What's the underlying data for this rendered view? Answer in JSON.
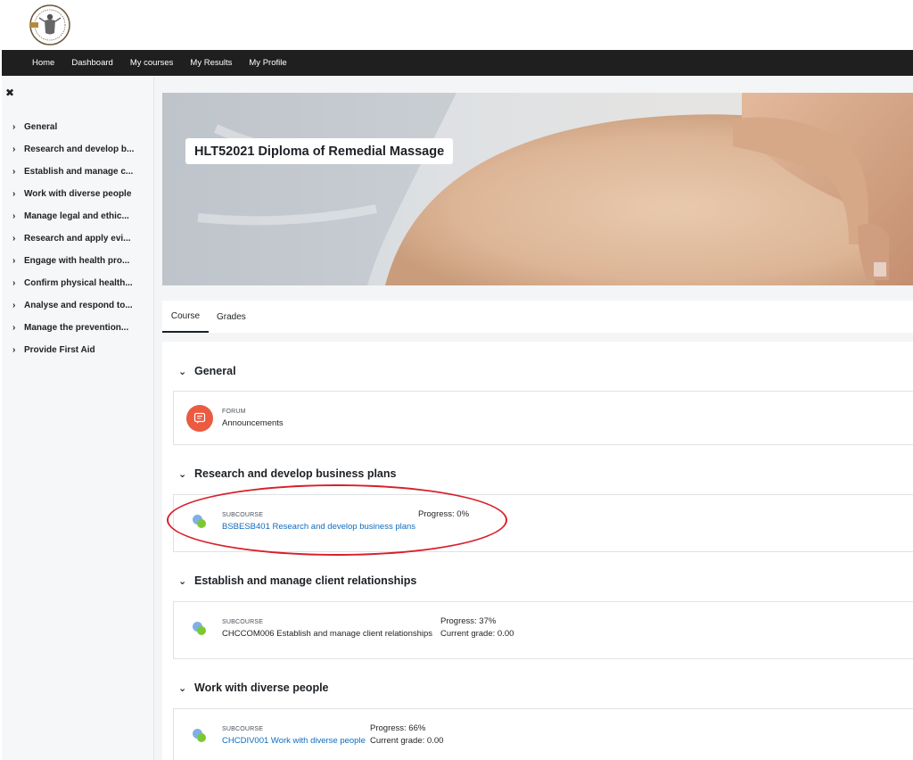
{
  "nav": {
    "items": [
      "Home",
      "Dashboard",
      "My courses",
      "My Results",
      "My Profile"
    ]
  },
  "sidebar": {
    "items": [
      "General",
      "Research and develop b...",
      "Establish and manage c...",
      "Work with diverse people",
      "Manage legal and ethic...",
      "Research and apply evi...",
      "Engage with health pro...",
      "Confirm physical health...",
      "Analyse and respond to...",
      "Manage the prevention...",
      "Provide First Aid"
    ]
  },
  "course": {
    "title": "HLT52021 Diploma of Remedial Massage"
  },
  "tabs": {
    "course": "Course",
    "grades": "Grades"
  },
  "sections": [
    {
      "title": "General",
      "activity": {
        "type": "FORUM",
        "name": "Announcements"
      }
    },
    {
      "title": "Research and develop business plans",
      "activity": {
        "type": "SUBCOURSE",
        "name": "BSBESB401 Research and develop business plans",
        "progress": "Progress: 0%"
      }
    },
    {
      "title": "Establish and manage client relationships",
      "activity": {
        "type": "SUBCOURSE",
        "name": "CHCCOM006 Establish and manage client relationships",
        "progress": "Progress: 37%",
        "grade": "Current grade: 0.00"
      }
    },
    {
      "title": "Work with diverse people",
      "activity": {
        "type": "SUBCOURSE",
        "name": "CHCDIV001 Work with diverse people",
        "progress": "Progress: 66%",
        "grade": "Current grade: 0.00"
      }
    }
  ],
  "colors": {
    "navbar": "#1f1f1f",
    "link": "#0f6cbf",
    "forum_icon": "#eb5a41",
    "annotation": "#d7202a"
  },
  "icons": {
    "close": "close-icon",
    "chevron_right": "chevron-right-icon",
    "chevron_down": "chevron-down-icon",
    "forum": "forum-icon",
    "subcourse": "subcourse-icon"
  }
}
